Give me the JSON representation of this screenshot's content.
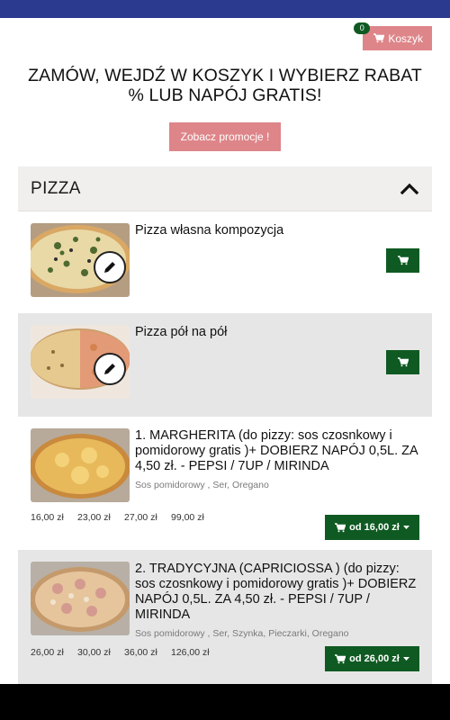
{
  "cart": {
    "label": "Koszyk",
    "count": "0"
  },
  "headline": "ZAMÓW, WEJDŹ W KOSZYK I WYBIERZ RABAT % LUB NAPÓJ GRATIS!",
  "promo_button": "Zobacz promocje !",
  "section": {
    "title": "PIZZA"
  },
  "items": [
    {
      "name": "Pizza własna kompozycja"
    },
    {
      "name": "Pizza pół na pół"
    },
    {
      "name": "1. MARGHERITA (do pizzy: sos czosnkowy i pomidorowy gratis )+ DOBIERZ NAPÓJ 0,5L. ZA 4,50 zł. - PEPSI / 7UP / MIRINDA",
      "ingredients": "Sos pomidorowy , Ser, Oregano",
      "prices": [
        "16,00 zł",
        "23,00 zł",
        "27,00 zł",
        "99,00 zł"
      ],
      "price_button": "od 16,00 zł"
    },
    {
      "name": "2. TRADYCYJNA (CAPRICIOSSA ) (do pizzy: sos czosnkowy i pomidorowy gratis )+ DOBIERZ NAPÓJ 0,5L. ZA 4,50 zł. - PEPSI / 7UP / MIRINDA",
      "ingredients": "Sos pomidorowy , Ser, Szynka, Pieczarki, Oregano",
      "prices": [
        "26,00 zł",
        "30,00 zł",
        "36,00 zł",
        "126,00 zł"
      ],
      "price_button": "od 26,00 zł"
    }
  ],
  "colors": {
    "accent_pink": "#de8589",
    "green": "#0f5a22",
    "status_bar": "#2b3a8f"
  },
  "icons": [
    "cart-icon",
    "chevron-up-icon",
    "pencil-icon",
    "caret-down-icon"
  ]
}
